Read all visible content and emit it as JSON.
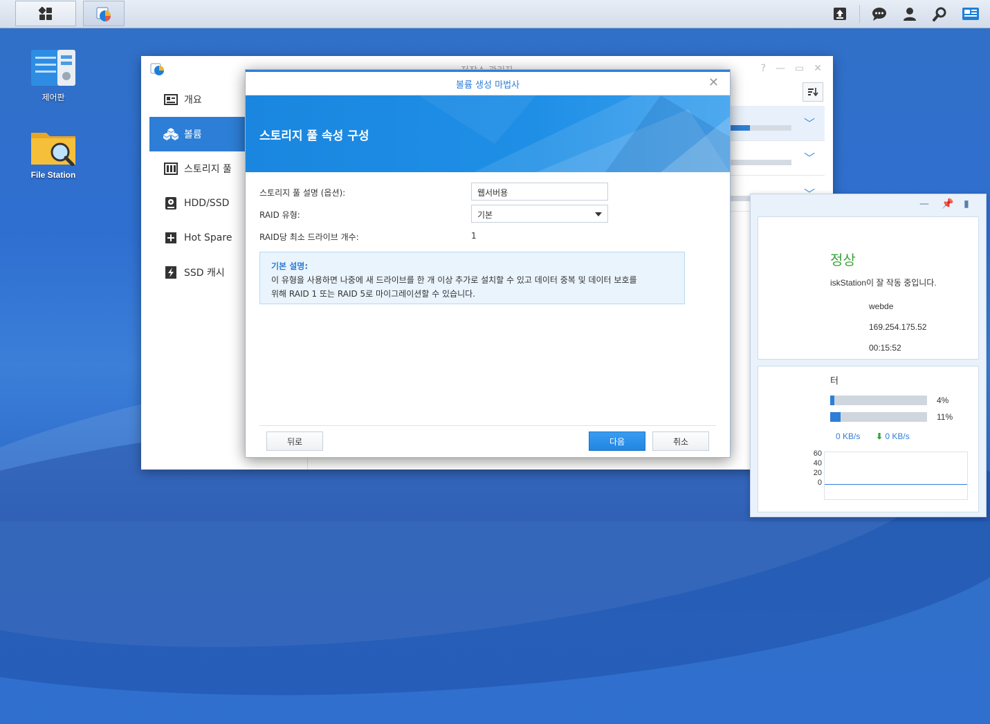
{
  "desktop": {
    "icons": [
      {
        "label": "제어판"
      },
      {
        "label": "File Station"
      }
    ]
  },
  "window": {
    "title": "저장소 관리자",
    "nav": [
      {
        "label": "개요"
      },
      {
        "label": "볼륨"
      },
      {
        "label": "스토리지 풀"
      },
      {
        "label": "HDD/SSD"
      },
      {
        "label": "Hot Spare"
      },
      {
        "label": "SSD 캐시"
      }
    ]
  },
  "dialog": {
    "title": "볼륨 생성 마법사",
    "banner_heading": "스토리지 풀 속성 구성",
    "fields": {
      "description_label": "스토리지 풀 설명 (옵션):",
      "description_value": "웹서버용",
      "raid_label": "RAID 유형:",
      "raid_value": "기본",
      "min_drives_label": "RAID당 최소 드라이브 개수:",
      "min_drives_value": "1"
    },
    "info": {
      "title": "기본 설명:",
      "line1": "이 유형을 사용하면 나중에 새 드라이브를 한 개 이상 추가로 설치할 수 있고 데이터 중복 및 데이터 보호를",
      "line2": "위해 RAID 1 또는 RAID 5로 마이그레이션할 수 있습니다."
    },
    "buttons": {
      "back": "뒤로",
      "next": "다음",
      "cancel": "취소"
    }
  },
  "widget": {
    "status": "정상",
    "status_message": "iskStation이 잘 작동 중입니다.",
    "server_name": "webde",
    "ip": "169.254.175.52",
    "uptime": "00:15:52",
    "monitor_title": "터",
    "cpu_percent": "4%",
    "ram_percent": "11%",
    "cpu_fill": 0.04,
    "ram_fill": 0.11,
    "upload_rate": "0 KB/s",
    "download_rate": "0 KB/s",
    "graph_ticks": [
      "60",
      "40",
      "20",
      "0"
    ]
  },
  "colors": {
    "accent": "#2d7ed6",
    "ok_green": "#3aa43a"
  }
}
